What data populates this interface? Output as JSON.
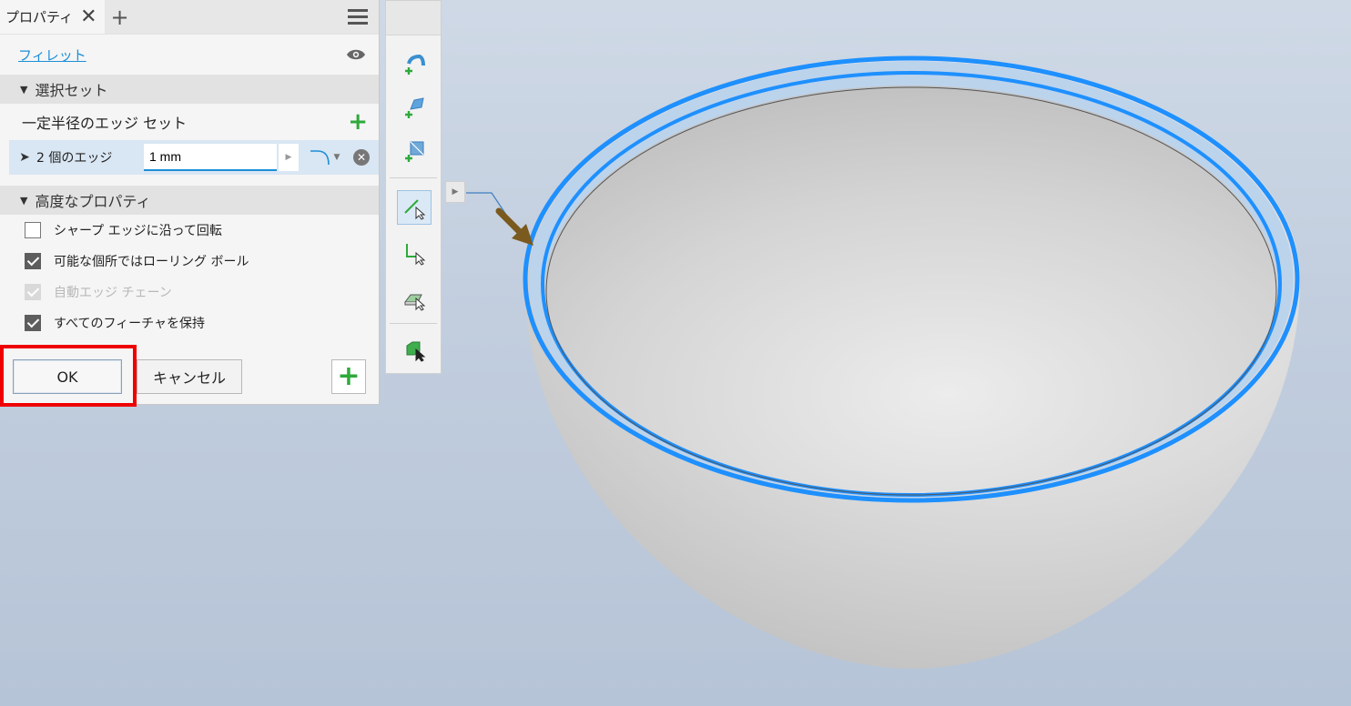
{
  "tab": {
    "title": "プロパティ",
    "close": "✕",
    "add": "+"
  },
  "feature": {
    "name": "フィレット"
  },
  "selection_set": {
    "header": "選択セット",
    "edge_set_label": "一定半径のエッジ セット",
    "add": "+",
    "selection_label": "2 個のエッジ",
    "radius_value": "1 mm",
    "remove": "✕"
  },
  "advanced": {
    "header": "高度なプロパティ",
    "options": [
      {
        "label": "シャープ エッジに沿って回転",
        "checked": false,
        "disabled": false
      },
      {
        "label": "可能な個所ではローリング ボール",
        "checked": true,
        "disabled": false
      },
      {
        "label": "自動エッジ チェーン",
        "checked": true,
        "disabled": true
      },
      {
        "label": "すべてのフィーチャを保持",
        "checked": true,
        "disabled": false
      }
    ]
  },
  "buttons": {
    "ok": "OK",
    "cancel": "キャンセル",
    "add": "+"
  },
  "toolbar_icons": [
    "add-fillet-icon",
    "add-variable-fillet-icon",
    "add-setback-icon",
    "edge-select-icon",
    "loop-select-icon",
    "feature-select-icon",
    "solid-select-icon"
  ],
  "colors": {
    "highlight": "#1e90ff",
    "ok_box": "#ee0000",
    "accent": "#1d8fd6",
    "plus": "#2eaa3a"
  }
}
